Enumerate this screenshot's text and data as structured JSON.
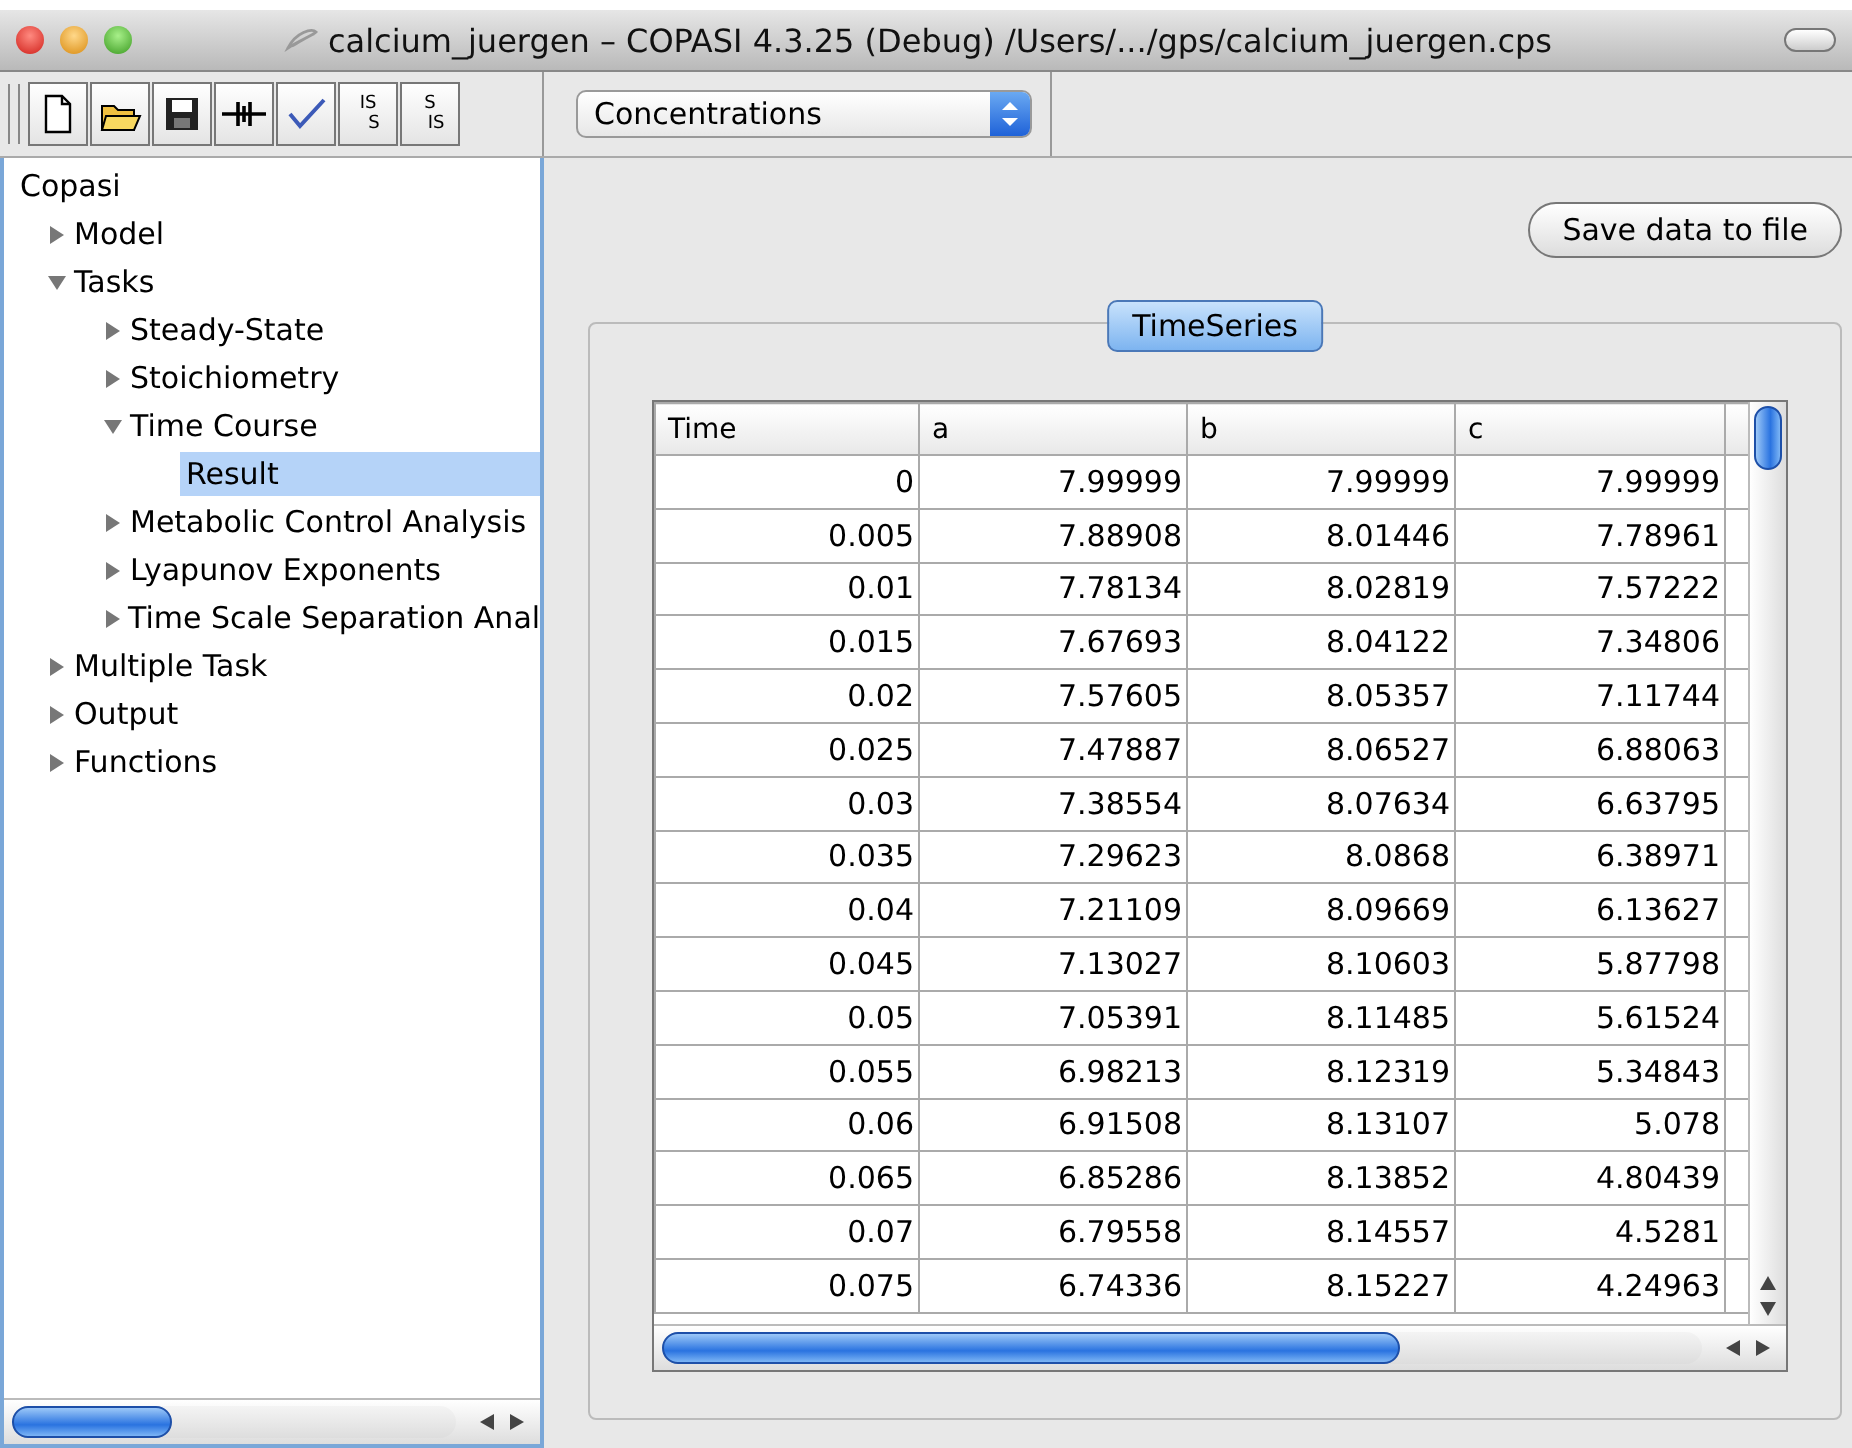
{
  "window": {
    "title": "calcium_juergen – COPASI 4.3.25 (Debug) /Users/.../gps/calcium_juergen.cps"
  },
  "toolbar": {
    "buttons": [
      {
        "kind": "new"
      },
      {
        "kind": "open"
      },
      {
        "kind": "save"
      },
      {
        "kind": "species"
      },
      {
        "kind": "check"
      },
      {
        "kind": "text",
        "label_top": "IS",
        "label_bottom": "S"
      },
      {
        "kind": "text",
        "label_top": "S",
        "label_bottom": "IS"
      }
    ],
    "dropdown": {
      "value": "Concentrations"
    }
  },
  "tree": [
    {
      "label": "Copasi",
      "selected": false,
      "children": [
        {
          "label": "Model",
          "expanded": false,
          "selected": false
        },
        {
          "label": "Tasks",
          "expanded": true,
          "selected": false,
          "children": [
            {
              "label": "Steady-State",
              "expanded": false,
              "selected": false
            },
            {
              "label": "Stoichiometry",
              "expanded": false,
              "selected": false
            },
            {
              "label": "Time Course",
              "expanded": true,
              "selected": false,
              "children": [
                {
                  "label": "Result",
                  "selected": true
                }
              ]
            },
            {
              "label": "Metabolic Control Analysis",
              "expanded": false,
              "selected": false
            },
            {
              "label": "Lyapunov Exponents",
              "expanded": false,
              "selected": false
            },
            {
              "label": "Time Scale Separation Anal",
              "expanded": false,
              "selected": false
            }
          ]
        },
        {
          "label": "Multiple Task",
          "expanded": false,
          "selected": false
        },
        {
          "label": "Output",
          "expanded": false,
          "selected": false
        },
        {
          "label": "Functions",
          "expanded": false,
          "selected": false
        }
      ]
    }
  ],
  "save_button": "Save data to file",
  "group": {
    "tab": "TimeSeries",
    "selected": true
  },
  "table": {
    "columns": [
      "Time",
      "a",
      "b",
      "c"
    ],
    "rows": [
      [
        "0",
        "7.99999",
        "7.99999",
        "7.99999"
      ],
      [
        "0.005",
        "7.88908",
        "8.01446",
        "7.78961"
      ],
      [
        "0.01",
        "7.78134",
        "8.02819",
        "7.57222"
      ],
      [
        "0.015",
        "7.67693",
        "8.04122",
        "7.34806"
      ],
      [
        "0.02",
        "7.57605",
        "8.05357",
        "7.11744"
      ],
      [
        "0.025",
        "7.47887",
        "8.06527",
        "6.88063"
      ],
      [
        "0.03",
        "7.38554",
        "8.07634",
        "6.63795"
      ],
      [
        "0.035",
        "7.29623",
        "8.0868",
        "6.38971"
      ],
      [
        "0.04",
        "7.21109",
        "8.09669",
        "6.13627"
      ],
      [
        "0.045",
        "7.13027",
        "8.10603",
        "5.87798"
      ],
      [
        "0.05",
        "7.05391",
        "8.11485",
        "5.61524"
      ],
      [
        "0.055",
        "6.98213",
        "8.12319",
        "5.34843"
      ],
      [
        "0.06",
        "6.91508",
        "8.13107",
        "5.078"
      ],
      [
        "0.065",
        "6.85286",
        "8.13852",
        "4.80439"
      ],
      [
        "0.07",
        "6.79558",
        "8.14557",
        "4.5281"
      ],
      [
        "0.075",
        "6.74336",
        "8.15227",
        "4.24963"
      ]
    ]
  }
}
